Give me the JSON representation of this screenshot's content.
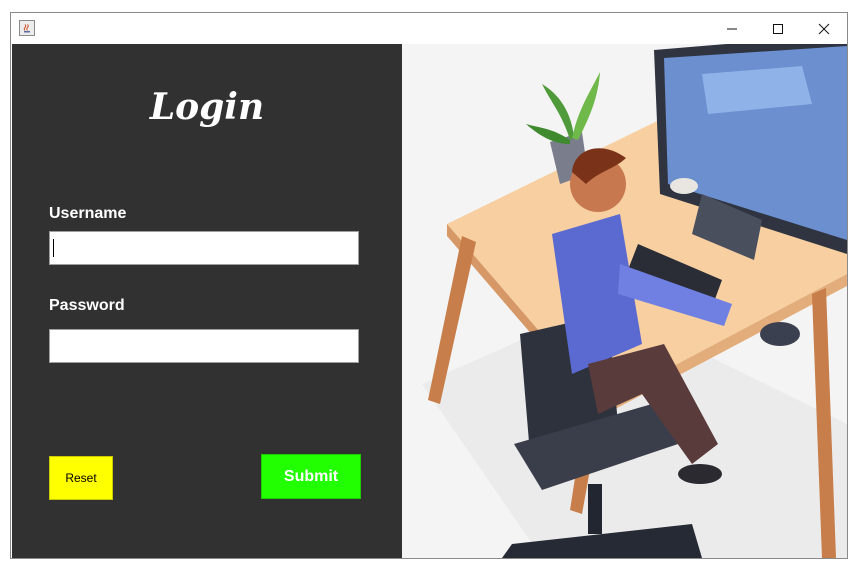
{
  "window": {
    "controls": {
      "minimize_icon": "minimize-icon",
      "maximize_icon": "maximize-icon",
      "close_icon": "close-icon"
    }
  },
  "login": {
    "title": "Login",
    "username_label": "Username",
    "username_value": "",
    "password_label": "Password",
    "password_value": "",
    "reset_label": "Reset",
    "submit_label": "Submit"
  },
  "colors": {
    "panel_bg": "#313131",
    "reset_bg": "#ffff00",
    "submit_bg": "#22ff00",
    "text": "#ffffff"
  },
  "illustration": {
    "subject": "office-worker-at-desk-illustration"
  }
}
